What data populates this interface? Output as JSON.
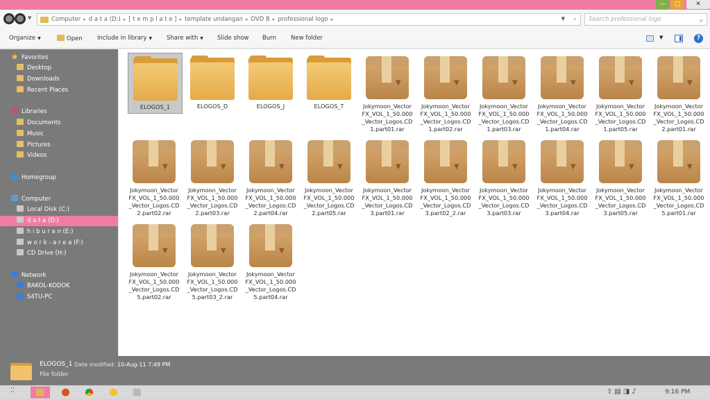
{
  "window": {
    "min_label": "—",
    "max_label": "▢",
    "close_label": "✕",
    "accent_color": "#f07ca6"
  },
  "address": {
    "crumbs": [
      "Computer",
      "d a t a (D:)",
      "[ t e m p l a t e ]",
      "template undangan",
      "DVD B",
      "professional logo"
    ],
    "search_placeholder": "Search professional logo"
  },
  "toolbar": {
    "organize": "Organize",
    "open": "Open",
    "include_in_library": "Include in library",
    "share_with": "Share with",
    "slide_show": "Slide show",
    "burn": "Burn",
    "new_folder": "New folder",
    "help": "?"
  },
  "sidebar": {
    "favorites": "Favorites",
    "desktop": "Desktop",
    "downloads": "Downloads",
    "recent_places": "Recent Places",
    "libraries": "Libraries",
    "documents": "Documents",
    "music": "Music",
    "pictures": "Pictures",
    "videos": "Videos",
    "homegroup": "Homegroup",
    "computer": "Computer",
    "local_disk": "Local Disk (C:)",
    "data": "d a t a (D:)",
    "hiburan": "h i b u r a n (E:)",
    "work_area": "w o r k - a r e a (F:)",
    "cd_drive": "CD Drive (H:)",
    "network": "Network",
    "bakol": "BAKOL-KODOK",
    "satu": "S4TU-PC"
  },
  "files": [
    {
      "name": "ELOGOS_1",
      "type": "folder"
    },
    {
      "name": "ELOGOS_D",
      "type": "folder"
    },
    {
      "name": "ELOGOS_J",
      "type": "folder"
    },
    {
      "name": "ELOGOS_T",
      "type": "folder"
    },
    {
      "name": "Jokymoon_VectorFX_VOL_1_50.000_Vector_Logos.CD1.part01.rar",
      "type": "archive"
    },
    {
      "name": "Jokymoon_VectorFX_VOL_1_50.000_Vector_Logos.CD1.part02.rar",
      "type": "archive"
    },
    {
      "name": "Jokymoon_VectorFX_VOL_1_50.000_Vector_Logos.CD1.part03.rar",
      "type": "archive"
    },
    {
      "name": "Jokymoon_VectorFX_VOL_1_50.000_Vector_Logos.CD1.part04.rar",
      "type": "archive"
    },
    {
      "name": "Jokymoon_VectorFX_VOL_1_50.000_Vector_Logos.CD1.part05.rar",
      "type": "archive"
    },
    {
      "name": "Jokymoon_VectorFX_VOL_1_50.000_Vector_Logos.CD2.part01.rar",
      "type": "archive"
    },
    {
      "name": "Jokymoon_VectorFX_VOL_1_50.000_Vector_Logos.CD2.part02.rar",
      "type": "archive"
    },
    {
      "name": "Jokymoon_VectorFX_VOL_1_50.000_Vector_Logos.CD2.part03.rar",
      "type": "archive"
    },
    {
      "name": "Jokymoon_VectorFX_VOL_1_50.000_Vector_Logos.CD2.part04.rar",
      "type": "archive"
    },
    {
      "name": "Jokymoon_VectorFX_VOL_1_50.000_Vector_Logos.CD2.part05.rar",
      "type": "archive"
    },
    {
      "name": "Jokymoon_VectorFX_VOL_1_50.000_Vector_Logos.CD3.part01.rar",
      "type": "archive"
    },
    {
      "name": "Jokymoon_VectorFX_VOL_1_50.000_Vector_Logos.CD3.part02_2.rar",
      "type": "archive"
    },
    {
      "name": "Jokymoon_VectorFX_VOL_1_50.000_Vector_Logos.CD3.part03.rar",
      "type": "archive"
    },
    {
      "name": "Jokymoon_VectorFX_VOL_1_50.000_Vector_Logos.CD3.part04.rar",
      "type": "archive"
    },
    {
      "name": "Jokymoon_VectorFX_VOL_1_50.000_Vector_Logos.CD3.part05.rar",
      "type": "archive"
    },
    {
      "name": "Jokymoon_VectorFX_VOL_1_50.000_Vector_Logos.CD5.part01.rar",
      "type": "archive"
    },
    {
      "name": "Jokymoon_VectorFX_VOL_1_50.000_Vector_Logos.CD5.part02.rar",
      "type": "archive"
    },
    {
      "name": "Jokymoon_VectorFX_VOL_1_50.000_Vector_Logos.CD5.part03_2.rar",
      "type": "archive"
    },
    {
      "name": "Jokymoon_VectorFX_VOL_1_50.000_Vector_Logos.CD5.part04.rar",
      "type": "archive"
    }
  ],
  "details": {
    "name": "ELOGOS_1",
    "modified_label": "Date modified:",
    "modified_value": "10-Aug-11 7:49 PM",
    "type": "File folder"
  },
  "taskbar": {
    "clock": "9:16 PM",
    "tray": "⇧▤◨♪"
  }
}
